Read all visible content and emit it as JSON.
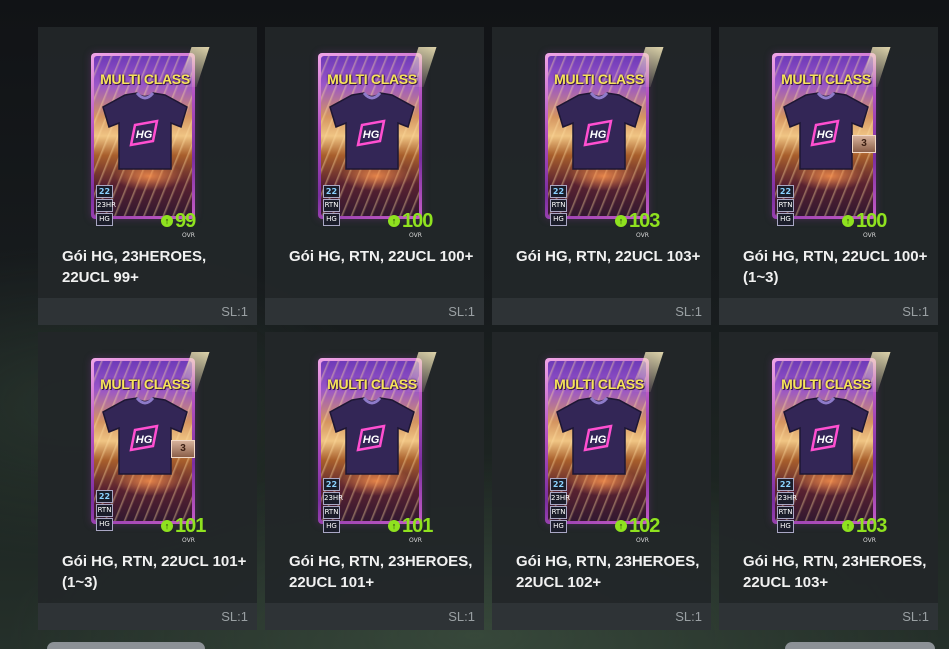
{
  "packs": [
    {
      "title": "Gói HG, 23HEROES, 22UCL 99+",
      "qty": "SL:1",
      "header": "MULTI CLASS",
      "ovr": "99",
      "ovr_label": "OVR",
      "badges": [
        "22",
        "23HR",
        "HG"
      ]
    },
    {
      "title": "Gói HG, RTN, 22UCL 100+",
      "qty": "SL:1",
      "header": "MULTI CLASS",
      "ovr": "100",
      "ovr_label": "OVR",
      "badges": [
        "22",
        "RTN",
        "HG"
      ]
    },
    {
      "title": "Gói HG, RTN, 22UCL 103+",
      "qty": "SL:1",
      "header": "MULTI CLASS",
      "ovr": "103",
      "ovr_label": "OVR",
      "badges": [
        "22",
        "RTN",
        "HG"
      ]
    },
    {
      "title": "Gói HG, RTN, 22UCL 100+ (1~3)",
      "qty": "SL:1",
      "header": "MULTI CLASS",
      "ovr": "100",
      "ovr_label": "OVR",
      "badges": [
        "22",
        "RTN",
        "HG"
      ],
      "rank": "3"
    },
    {
      "title": "Gói HG, RTN, 22UCL 101+ (1~3)",
      "qty": "SL:1",
      "header": "MULTI CLASS",
      "ovr": "101",
      "ovr_label": "OVR",
      "badges": [
        "22",
        "RTN",
        "HG"
      ],
      "rank": "3"
    },
    {
      "title": "Gói HG, RTN, 23HEROES, 22UCL 101+",
      "qty": "SL:1",
      "header": "MULTI CLASS",
      "ovr": "101",
      "ovr_label": "OVR",
      "badges": [
        "22",
        "23HR",
        "RTN",
        "HG"
      ]
    },
    {
      "title": "Gói HG, RTN, 23HEROES, 22UCL 102+",
      "qty": "SL:1",
      "header": "MULTI CLASS",
      "ovr": "102",
      "ovr_label": "OVR",
      "badges": [
        "22",
        "23HR",
        "RTN",
        "HG"
      ]
    },
    {
      "title": "Gói HG, RTN, 23HEROES, 22UCL 103+",
      "qty": "SL:1",
      "header": "MULTI CLASS",
      "ovr": "103",
      "ovr_label": "OVR",
      "badges": [
        "22",
        "23HR",
        "RTN",
        "HG"
      ]
    }
  ],
  "colors": {
    "ovr_green": "#8fe21f",
    "header_yellow": "#f7e45a",
    "tile_bg": "#222629",
    "footer_bg": "#2f3437"
  },
  "icons": {
    "ovr_arrow": "up-arrow-icon",
    "shirt": "jersey-icon",
    "rank": "rank-plate-icon"
  }
}
